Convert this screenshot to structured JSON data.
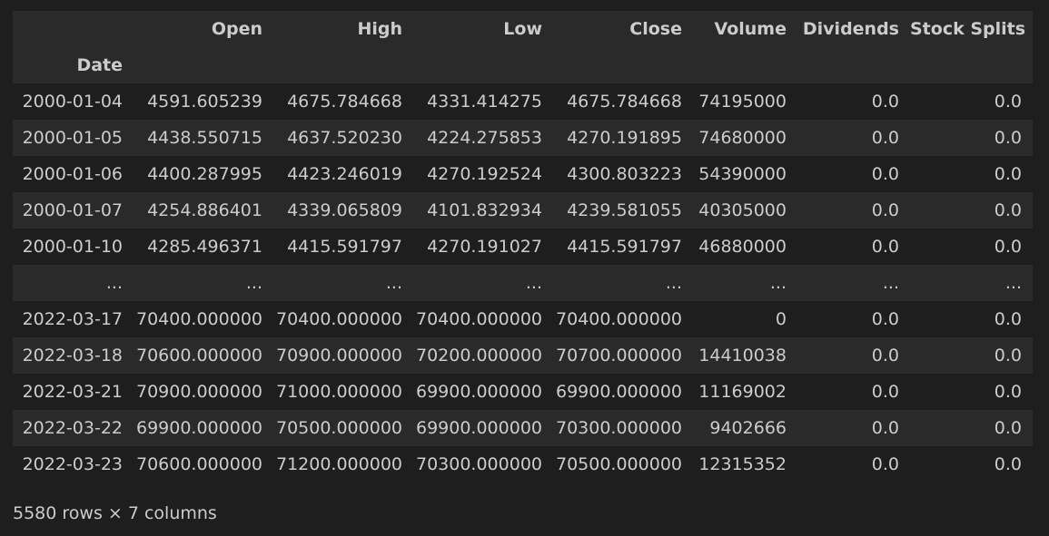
{
  "table": {
    "columns": [
      "Open",
      "High",
      "Low",
      "Close",
      "Volume",
      "Dividends",
      "Stock Splits"
    ],
    "index_name": "Date",
    "rows": [
      {
        "index": "2000-01-04",
        "values": [
          "4591.605239",
          "4675.784668",
          "4331.414275",
          "4675.784668",
          "74195000",
          "0.0",
          "0.0"
        ]
      },
      {
        "index": "2000-01-05",
        "values": [
          "4438.550715",
          "4637.520230",
          "4224.275853",
          "4270.191895",
          "74680000",
          "0.0",
          "0.0"
        ]
      },
      {
        "index": "2000-01-06",
        "values": [
          "4400.287995",
          "4423.246019",
          "4270.192524",
          "4300.803223",
          "54390000",
          "0.0",
          "0.0"
        ]
      },
      {
        "index": "2000-01-07",
        "values": [
          "4254.886401",
          "4339.065809",
          "4101.832934",
          "4239.581055",
          "40305000",
          "0.0",
          "0.0"
        ]
      },
      {
        "index": "2000-01-10",
        "values": [
          "4285.496371",
          "4415.591797",
          "4270.191027",
          "4415.591797",
          "46880000",
          "0.0",
          "0.0"
        ]
      },
      {
        "index": "...",
        "values": [
          "...",
          "...",
          "...",
          "...",
          "...",
          "...",
          "..."
        ]
      },
      {
        "index": "2022-03-17",
        "values": [
          "70400.000000",
          "70400.000000",
          "70400.000000",
          "70400.000000",
          "0",
          "0.0",
          "0.0"
        ]
      },
      {
        "index": "2022-03-18",
        "values": [
          "70600.000000",
          "70900.000000",
          "70200.000000",
          "70700.000000",
          "14410038",
          "0.0",
          "0.0"
        ]
      },
      {
        "index": "2022-03-21",
        "values": [
          "70900.000000",
          "71000.000000",
          "69900.000000",
          "69900.000000",
          "11169002",
          "0.0",
          "0.0"
        ]
      },
      {
        "index": "2022-03-22",
        "values": [
          "69900.000000",
          "70500.000000",
          "69900.000000",
          "70300.000000",
          "9402666",
          "0.0",
          "0.0"
        ]
      },
      {
        "index": "2022-03-23",
        "values": [
          "70600.000000",
          "71200.000000",
          "70300.000000",
          "70500.000000",
          "12315352",
          "0.0",
          "0.0"
        ]
      }
    ]
  },
  "footer": {
    "shape_text": "5580 rows × 7 columns"
  },
  "colors": {
    "background": "#1e1e1e",
    "row_alt": "#2a2a2a",
    "text": "#cccccc"
  }
}
